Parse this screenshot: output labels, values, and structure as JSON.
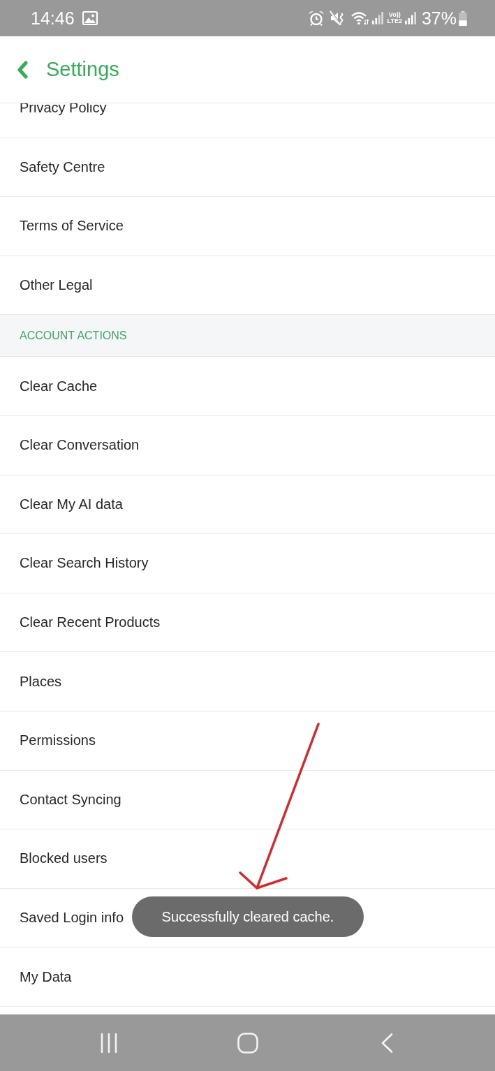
{
  "status_bar": {
    "time": "14:46",
    "network_badge": [
      "Vo))",
      "LTE2"
    ],
    "battery": "37%"
  },
  "header": {
    "title": "Settings"
  },
  "sections": [
    {
      "items": [
        "Privacy Policy",
        "Safety Centre",
        "Terms of Service",
        "Other Legal"
      ]
    },
    {
      "title": "ACCOUNT ACTIONS",
      "items": [
        "Clear Cache",
        "Clear Conversation",
        "Clear My AI data",
        "Clear Search History",
        "Clear Recent Products",
        "Places",
        "Permissions",
        "Contact Syncing",
        "Blocked users",
        "Saved Login info",
        "My Data"
      ]
    }
  ],
  "toast": {
    "message": "Successfully cleared cache."
  }
}
